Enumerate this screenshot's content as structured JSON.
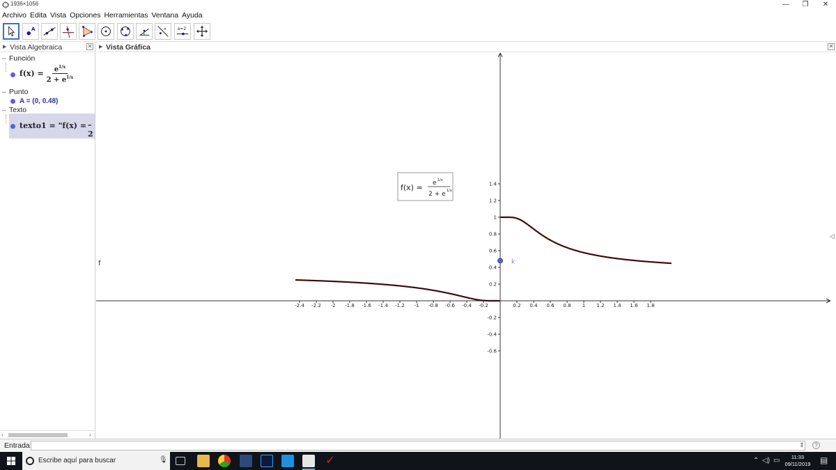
{
  "window": {
    "title": "1936×1056",
    "minimize": "—",
    "restore": "❐",
    "close": "✕"
  },
  "menu": [
    "Archivo",
    "Edita",
    "Vista",
    "Opciones",
    "Herramientas",
    "Ventana",
    "Ayuda"
  ],
  "toolbar": {
    "tools": [
      "move-tool",
      "point-tool",
      "line-tool",
      "perpendicular-tool",
      "polygon-tool",
      "circle-tool",
      "conic-tool",
      "angle-tool",
      "reflect-tool",
      "slider-tool",
      "move-view-tool"
    ],
    "slider_label": "a=2"
  },
  "algebra": {
    "title": "Vista Algebraica",
    "categories": {
      "function": "Función",
      "point": "Punto",
      "text": "Texto"
    },
    "function_lhs": "f(x) =",
    "function_num": "e",
    "function_den": "2 + e",
    "exp_mark": "1/x",
    "point": "A = (0, 0.48)",
    "text_obj": "texto1 = \"f(x) = ",
    "text_tail": "2"
  },
  "graphics": {
    "title": "Vista Gráfica",
    "function_label": "f",
    "point_label": "k",
    "formula_lhs": "f(x) =",
    "formula_num": "e",
    "formula_den": "2 + e",
    "curve_color": "#3d0c0c",
    "point_color": "#5b5ee0"
  },
  "chart_data": {
    "type": "line",
    "function": "f(x) = e^(1/x) / (2 + e^(1/x))",
    "xlim": [
      -2.45,
      2.0
    ],
    "ylim": [
      -0.8,
      1.5
    ],
    "x_ticks": [
      -2.4,
      -2.2,
      -2,
      -1.8,
      -1.6,
      -1.4,
      -1.2,
      -1,
      -0.8,
      -0.6,
      -0.4,
      -0.2,
      0.2,
      0.4,
      0.6,
      0.8,
      1,
      1.2,
      1.4,
      1.6,
      1.8
    ],
    "x_tick_labels": [
      "-2.4",
      "-2.2",
      "-2",
      "-1.8",
      "-1.6",
      "-1.4",
      "-1.2",
      "-1",
      "-0.8",
      "-0.6",
      "-0.4",
      "-0.2",
      "0.2",
      "0.4",
      "0.6",
      "0.8",
      "1",
      "1.2",
      "1.4",
      "1.6",
      "1.8"
    ],
    "y_ticks": [
      -0.6,
      -0.4,
      -0.2,
      0.2,
      0.4,
      0.6,
      0.8,
      1,
      1.2,
      1.4
    ],
    "y_tick_labels": [
      "-0.6",
      "-0.4",
      "-0.2",
      "0.2",
      "0.4",
      "0.6",
      "0.8",
      "1",
      "1.2",
      "1.4"
    ],
    "point": {
      "name": "A",
      "x": 0,
      "y": 0.48
    },
    "grid": false
  },
  "input": {
    "label": "Entrada:",
    "value": ""
  },
  "taskbar": {
    "search_placeholder": "Escribe aquí para buscar",
    "time": "11:33",
    "date": "09/11/2019"
  }
}
